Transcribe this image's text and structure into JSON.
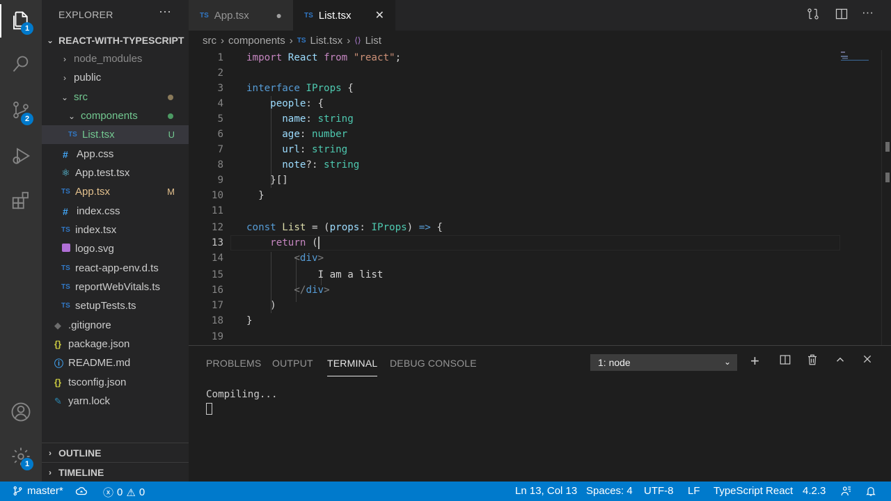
{
  "activity": {
    "explorer_badge": "1",
    "scm_badge": "2",
    "settings_badge": "1"
  },
  "sidebar": {
    "title": "EXPLORER",
    "more": "···",
    "project": "REACT-WITH-TYPESCRIPT",
    "files": [
      {
        "label": "node_modules",
        "icon": "",
        "badge": ""
      },
      {
        "label": "public",
        "icon": "",
        "badge": ""
      },
      {
        "label": "src",
        "icon": "",
        "badge": ""
      },
      {
        "label": "components",
        "icon": "",
        "badge": ""
      },
      {
        "label": "List.tsx",
        "icon": "TS",
        "badge": "U"
      },
      {
        "label": "App.css",
        "icon": "#",
        "badge": ""
      },
      {
        "label": "App.test.tsx",
        "icon": "⚛",
        "badge": ""
      },
      {
        "label": "App.tsx",
        "icon": "TS",
        "badge": "M"
      },
      {
        "label": "index.css",
        "icon": "#",
        "badge": ""
      },
      {
        "label": "index.tsx",
        "icon": "TS",
        "badge": ""
      },
      {
        "label": "logo.svg",
        "icon": "",
        "badge": ""
      },
      {
        "label": "react-app-env.d.ts",
        "icon": "TS",
        "badge": ""
      },
      {
        "label": "reportWebVitals.ts",
        "icon": "TS",
        "badge": ""
      },
      {
        "label": "setupTests.ts",
        "icon": "TS",
        "badge": ""
      },
      {
        "label": ".gitignore",
        "icon": "",
        "badge": ""
      },
      {
        "label": "package.json",
        "icon": "{}",
        "badge": ""
      },
      {
        "label": "README.md",
        "icon": "",
        "badge": ""
      },
      {
        "label": "tsconfig.json",
        "icon": "{}",
        "badge": ""
      },
      {
        "label": "yarn.lock",
        "icon": "",
        "badge": ""
      }
    ],
    "outline": "OUTLINE",
    "timeline": "TIMELINE"
  },
  "tabs": [
    {
      "icon": "TS",
      "label": "App.tsx"
    },
    {
      "icon": "TS",
      "label": "List.tsx"
    }
  ],
  "breadcrumb": {
    "parts": [
      "src",
      "components",
      "List.tsx",
      "List"
    ],
    "file_icon": "TS"
  },
  "editor": {
    "line_numbers": [
      "1",
      "2",
      "3",
      "4",
      "5",
      "6",
      "7",
      "8",
      "9",
      "10",
      "11",
      "12",
      "13",
      "14",
      "15",
      "16",
      "17",
      "18",
      "19"
    ]
  },
  "panel": {
    "tabs": [
      "PROBLEMS",
      "OUTPUT",
      "TERMINAL",
      "DEBUG CONSOLE"
    ],
    "terminal_select": "1: node",
    "terminal_output": "Compiling..."
  },
  "status": {
    "branch": "master*",
    "errors": "0",
    "warnings": "0",
    "position": "Ln 13, Col 13",
    "spaces": "Spaces: 4",
    "encoding": "UTF-8",
    "eol": "LF",
    "language": "TypeScript React",
    "version": "4.2.3"
  },
  "colors": {
    "status_bar": "#007acc",
    "activity_bar": "#333333",
    "sidebar": "#252526",
    "editor": "#1e1e1e",
    "untracked": "#73c991",
    "modified": "#e2c08d"
  }
}
